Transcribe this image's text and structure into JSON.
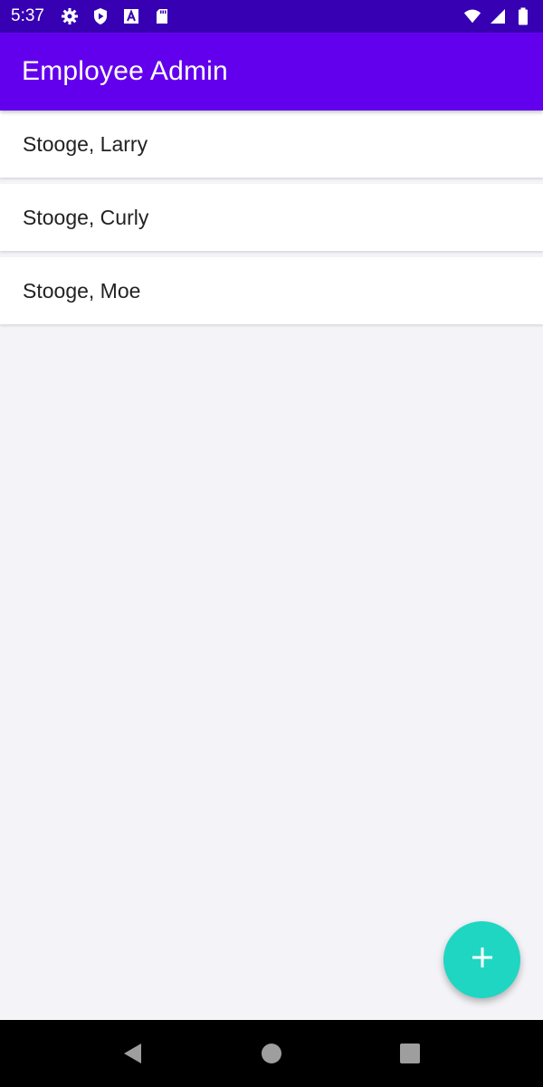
{
  "status_bar": {
    "time": "5:37",
    "left_icons": [
      "gear-icon",
      "shield-play-icon",
      "font-a-icon",
      "sd-card-icon"
    ],
    "right_icons": [
      "wifi-icon",
      "cell-signal-icon",
      "battery-icon"
    ]
  },
  "app_bar": {
    "title": "Employee Admin",
    "color": "#6200ee"
  },
  "employees": [
    {
      "name": "Stooge, Larry"
    },
    {
      "name": "Stooge, Curly"
    },
    {
      "name": "Stooge, Moe"
    }
  ],
  "fab": {
    "icon": "plus-icon",
    "color": "#1fd6c3"
  },
  "nav_bar": {
    "buttons": [
      "back-icon",
      "home-icon",
      "recents-icon"
    ]
  }
}
